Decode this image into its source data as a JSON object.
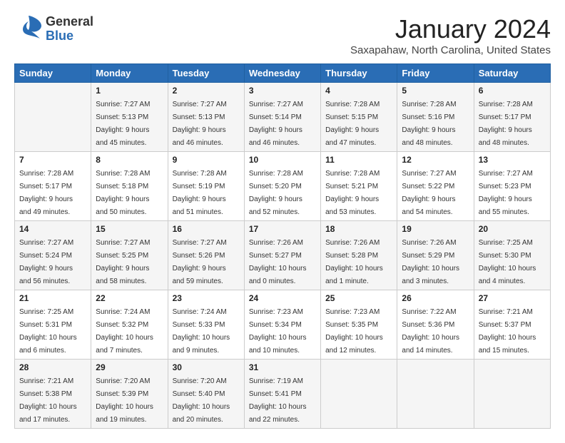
{
  "header": {
    "logo_general": "General",
    "logo_blue": "Blue",
    "month_year": "January 2024",
    "location": "Saxapahaw, North Carolina, United States"
  },
  "weekdays": [
    "Sunday",
    "Monday",
    "Tuesday",
    "Wednesday",
    "Thursday",
    "Friday",
    "Saturday"
  ],
  "weeks": [
    [
      {
        "day": "",
        "sunrise": "",
        "sunset": "",
        "daylight": ""
      },
      {
        "day": "1",
        "sunrise": "Sunrise: 7:27 AM",
        "sunset": "Sunset: 5:13 PM",
        "daylight": "Daylight: 9 hours and 45 minutes."
      },
      {
        "day": "2",
        "sunrise": "Sunrise: 7:27 AM",
        "sunset": "Sunset: 5:13 PM",
        "daylight": "Daylight: 9 hours and 46 minutes."
      },
      {
        "day": "3",
        "sunrise": "Sunrise: 7:27 AM",
        "sunset": "Sunset: 5:14 PM",
        "daylight": "Daylight: 9 hours and 46 minutes."
      },
      {
        "day": "4",
        "sunrise": "Sunrise: 7:28 AM",
        "sunset": "Sunset: 5:15 PM",
        "daylight": "Daylight: 9 hours and 47 minutes."
      },
      {
        "day": "5",
        "sunrise": "Sunrise: 7:28 AM",
        "sunset": "Sunset: 5:16 PM",
        "daylight": "Daylight: 9 hours and 48 minutes."
      },
      {
        "day": "6",
        "sunrise": "Sunrise: 7:28 AM",
        "sunset": "Sunset: 5:17 PM",
        "daylight": "Daylight: 9 hours and 48 minutes."
      }
    ],
    [
      {
        "day": "7",
        "sunrise": "Sunrise: 7:28 AM",
        "sunset": "Sunset: 5:17 PM",
        "daylight": "Daylight: 9 hours and 49 minutes."
      },
      {
        "day": "8",
        "sunrise": "Sunrise: 7:28 AM",
        "sunset": "Sunset: 5:18 PM",
        "daylight": "Daylight: 9 hours and 50 minutes."
      },
      {
        "day": "9",
        "sunrise": "Sunrise: 7:28 AM",
        "sunset": "Sunset: 5:19 PM",
        "daylight": "Daylight: 9 hours and 51 minutes."
      },
      {
        "day": "10",
        "sunrise": "Sunrise: 7:28 AM",
        "sunset": "Sunset: 5:20 PM",
        "daylight": "Daylight: 9 hours and 52 minutes."
      },
      {
        "day": "11",
        "sunrise": "Sunrise: 7:28 AM",
        "sunset": "Sunset: 5:21 PM",
        "daylight": "Daylight: 9 hours and 53 minutes."
      },
      {
        "day": "12",
        "sunrise": "Sunrise: 7:27 AM",
        "sunset": "Sunset: 5:22 PM",
        "daylight": "Daylight: 9 hours and 54 minutes."
      },
      {
        "day": "13",
        "sunrise": "Sunrise: 7:27 AM",
        "sunset": "Sunset: 5:23 PM",
        "daylight": "Daylight: 9 hours and 55 minutes."
      }
    ],
    [
      {
        "day": "14",
        "sunrise": "Sunrise: 7:27 AM",
        "sunset": "Sunset: 5:24 PM",
        "daylight": "Daylight: 9 hours and 56 minutes."
      },
      {
        "day": "15",
        "sunrise": "Sunrise: 7:27 AM",
        "sunset": "Sunset: 5:25 PM",
        "daylight": "Daylight: 9 hours and 58 minutes."
      },
      {
        "day": "16",
        "sunrise": "Sunrise: 7:27 AM",
        "sunset": "Sunset: 5:26 PM",
        "daylight": "Daylight: 9 hours and 59 minutes."
      },
      {
        "day": "17",
        "sunrise": "Sunrise: 7:26 AM",
        "sunset": "Sunset: 5:27 PM",
        "daylight": "Daylight: 10 hours and 0 minutes."
      },
      {
        "day": "18",
        "sunrise": "Sunrise: 7:26 AM",
        "sunset": "Sunset: 5:28 PM",
        "daylight": "Daylight: 10 hours and 1 minute."
      },
      {
        "day": "19",
        "sunrise": "Sunrise: 7:26 AM",
        "sunset": "Sunset: 5:29 PM",
        "daylight": "Daylight: 10 hours and 3 minutes."
      },
      {
        "day": "20",
        "sunrise": "Sunrise: 7:25 AM",
        "sunset": "Sunset: 5:30 PM",
        "daylight": "Daylight: 10 hours and 4 minutes."
      }
    ],
    [
      {
        "day": "21",
        "sunrise": "Sunrise: 7:25 AM",
        "sunset": "Sunset: 5:31 PM",
        "daylight": "Daylight: 10 hours and 6 minutes."
      },
      {
        "day": "22",
        "sunrise": "Sunrise: 7:24 AM",
        "sunset": "Sunset: 5:32 PM",
        "daylight": "Daylight: 10 hours and 7 minutes."
      },
      {
        "day": "23",
        "sunrise": "Sunrise: 7:24 AM",
        "sunset": "Sunset: 5:33 PM",
        "daylight": "Daylight: 10 hours and 9 minutes."
      },
      {
        "day": "24",
        "sunrise": "Sunrise: 7:23 AM",
        "sunset": "Sunset: 5:34 PM",
        "daylight": "Daylight: 10 hours and 10 minutes."
      },
      {
        "day": "25",
        "sunrise": "Sunrise: 7:23 AM",
        "sunset": "Sunset: 5:35 PM",
        "daylight": "Daylight: 10 hours and 12 minutes."
      },
      {
        "day": "26",
        "sunrise": "Sunrise: 7:22 AM",
        "sunset": "Sunset: 5:36 PM",
        "daylight": "Daylight: 10 hours and 14 minutes."
      },
      {
        "day": "27",
        "sunrise": "Sunrise: 7:21 AM",
        "sunset": "Sunset: 5:37 PM",
        "daylight": "Daylight: 10 hours and 15 minutes."
      }
    ],
    [
      {
        "day": "28",
        "sunrise": "Sunrise: 7:21 AM",
        "sunset": "Sunset: 5:38 PM",
        "daylight": "Daylight: 10 hours and 17 minutes."
      },
      {
        "day": "29",
        "sunrise": "Sunrise: 7:20 AM",
        "sunset": "Sunset: 5:39 PM",
        "daylight": "Daylight: 10 hours and 19 minutes."
      },
      {
        "day": "30",
        "sunrise": "Sunrise: 7:20 AM",
        "sunset": "Sunset: 5:40 PM",
        "daylight": "Daylight: 10 hours and 20 minutes."
      },
      {
        "day": "31",
        "sunrise": "Sunrise: 7:19 AM",
        "sunset": "Sunset: 5:41 PM",
        "daylight": "Daylight: 10 hours and 22 minutes."
      },
      {
        "day": "",
        "sunrise": "",
        "sunset": "",
        "daylight": ""
      },
      {
        "day": "",
        "sunrise": "",
        "sunset": "",
        "daylight": ""
      },
      {
        "day": "",
        "sunrise": "",
        "sunset": "",
        "daylight": ""
      }
    ]
  ]
}
